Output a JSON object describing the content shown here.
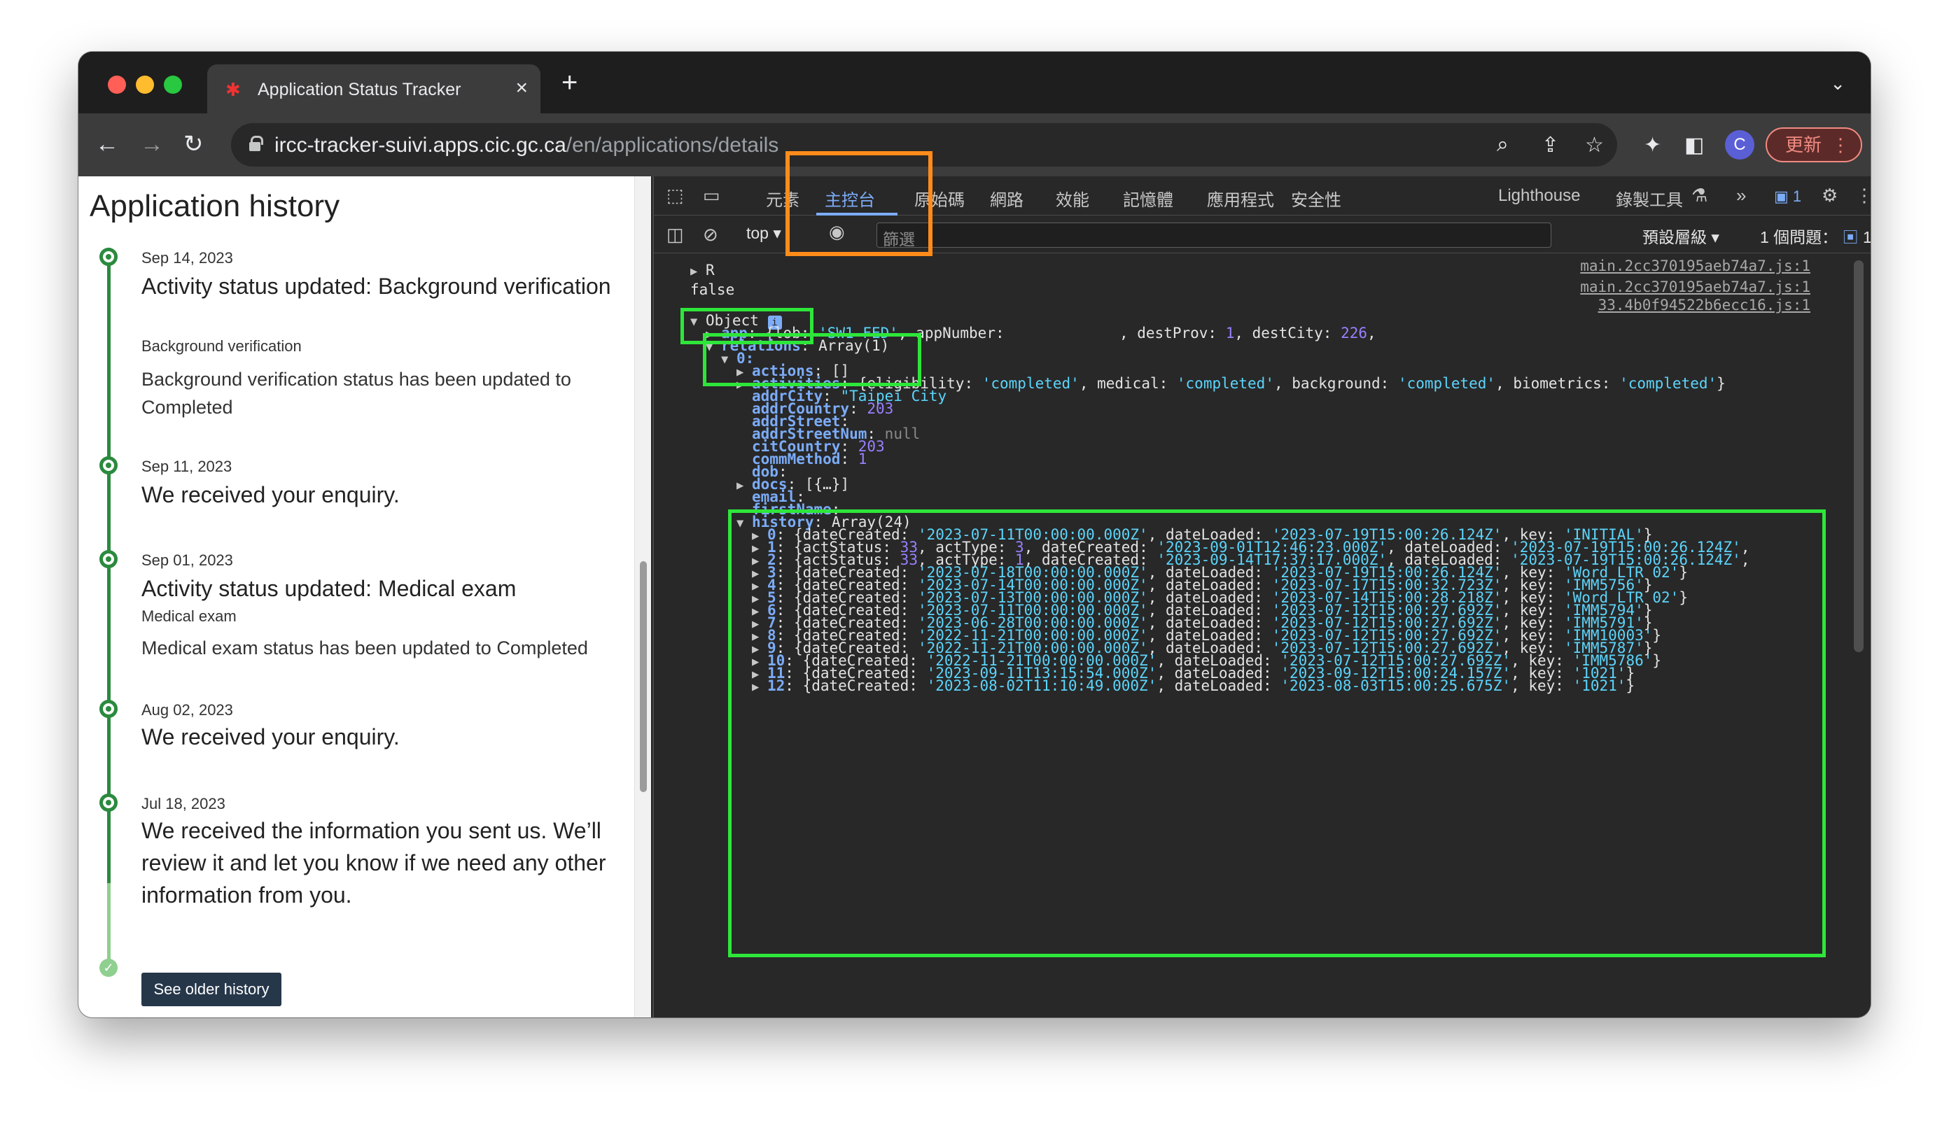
{
  "browser": {
    "tab_title": "Application Status Tracker",
    "url_host": "ircc-tracker-suivi.apps.cic.gc.ca",
    "url_path": "/en/applications/details",
    "avatar_letter": "C",
    "update_label": "更新"
  },
  "page": {
    "title": "Application history",
    "events": [
      {
        "date": "Sep 14, 2023",
        "title": "Activity status updated: Background verification",
        "subtitle": "Background verification",
        "description": "Background verification status has been updated to Completed"
      },
      {
        "date": "Sep 11, 2023",
        "title": "We received your enquiry."
      },
      {
        "date": "Sep 01, 2023",
        "title": "Activity status updated: Medical exam",
        "subtitle": "Medical exam",
        "description": "Medical exam status has been updated to Completed"
      },
      {
        "date": "Aug 02, 2023",
        "title": "We received your enquiry."
      },
      {
        "date": "Jul 18, 2023",
        "title": "We received the information you sent us. We’ll review it and let you know if we need any other information from you."
      }
    ],
    "older_button": "See older history"
  },
  "devtools": {
    "tabs": [
      "元素",
      "主控台",
      "原始碼",
      "網路",
      "效能",
      "記憶體",
      "應用程式",
      "安全性",
      "Lighthouse",
      "錄製工具"
    ],
    "active_tab": "主控台",
    "issue_badge_count": "1",
    "context": "top",
    "filter_placeholder": "篩選",
    "default_levels": "預設層級",
    "issues_label": "1 個問題：",
    "issues_count": "1",
    "sources": [
      "main.2cc370195aeb74a7.js:1",
      "main.2cc370195aeb74a7.js:1",
      "33.4b0f94522b6ecc16.js:1"
    ],
    "console": {
      "line_r": "R",
      "line_false": "false",
      "object_label": "Object",
      "app_key": "app",
      "app_value_start": "{lob: ",
      "app_lob": "'SW1-FED'",
      "app_value_mid": ", appNumber: ",
      "app_value_rest": ", destProv: ",
      "app_destProv": "1",
      "app_destCity_label": ", destCity: ",
      "app_destCity": "226",
      "relations_key": "relations",
      "relations_value": "Array(1)",
      "index0": "0:",
      "actions_key": "actions",
      "actions_value": "[]",
      "activities_key": "activities",
      "activities_eligibility": "'completed'",
      "activities_medical": "'completed'",
      "activities_background": "'completed'",
      "activities_biometrics": "'completed'",
      "addrCity_key": "addrCity",
      "addrCity_value": "\"Taipei City",
      "addrCountry_key": "addrCountry",
      "addrCountry_value": "203",
      "addrStreet_key": "addrStreet",
      "addrStreetNum_key": "addrStreetNum",
      "addrStreetNum_value": "null",
      "citCountry_key": "citCountry",
      "citCountry_value": "203",
      "commMethod_key": "commMethod",
      "commMethod_value": "1",
      "dob_key": "dob",
      "docs_key": "docs",
      "docs_value": "[{…}]",
      "email_key": "email",
      "firstName_key": "firstName",
      "history_key": "history",
      "history_value": "Array(24)",
      "history": [
        {
          "idx": "0",
          "dateCreated": "'2023-07-11T00:00:00.000Z'",
          "dateLoaded": "'2023-07-19T15:00:26.124Z'",
          "key": "'INITIAL'"
        },
        {
          "idx": "1",
          "actStatus": "33",
          "actType": "3",
          "dateCreated": "'2023-09-01T12:46:23.000Z'",
          "dateLoaded": "'2023-07-19T15:00:26.124Z'"
        },
        {
          "idx": "2",
          "actStatus": "33",
          "actType": "1",
          "dateCreated": "'2023-09-14T17:37:17.000Z'",
          "dateLoaded": "'2023-07-19T15:00:26.124Z'"
        },
        {
          "idx": "3",
          "dateCreated": "'2023-07-18T00:00:00.000Z'",
          "dateLoaded": "'2023-07-19T15:00:26.124Z'",
          "key": "'Word LTR 02'"
        },
        {
          "idx": "4",
          "dateCreated": "'2023-07-14T00:00:00.000Z'",
          "dateLoaded": "'2023-07-17T15:00:32.723Z'",
          "key": "'IMM5756'"
        },
        {
          "idx": "5",
          "dateCreated": "'2023-07-13T00:00:00.000Z'",
          "dateLoaded": "'2023-07-14T15:00:28.218Z'",
          "key": "'Word LTR 02'"
        },
        {
          "idx": "6",
          "dateCreated": "'2023-07-11T00:00:00.000Z'",
          "dateLoaded": "'2023-07-12T15:00:27.692Z'",
          "key": "'IMM5794'"
        },
        {
          "idx": "7",
          "dateCreated": "'2023-06-28T00:00:00.000Z'",
          "dateLoaded": "'2023-07-12T15:00:27.692Z'",
          "key": "'IMM5791'"
        },
        {
          "idx": "8",
          "dateCreated": "'2022-11-21T00:00:00.000Z'",
          "dateLoaded": "'2023-07-12T15:00:27.692Z'",
          "key": "'IMM10003'"
        },
        {
          "idx": "9",
          "dateCreated": "'2022-11-21T00:00:00.000Z'",
          "dateLoaded": "'2023-07-12T15:00:27.692Z'",
          "key": "'IMM5787'"
        },
        {
          "idx": "10",
          "dateCreated": "'2022-11-21T00:00:00.000Z'",
          "dateLoaded": "'2023-07-12T15:00:27.692Z'",
          "key": "'IMM5786'"
        },
        {
          "idx": "11",
          "dateCreated": "'2023-09-11T13:15:54.000Z'",
          "dateLoaded": "'2023-09-12T15:00:24.157Z'",
          "key": "'1021'"
        },
        {
          "idx": "12",
          "dateCreated": "'2023-08-02T11:10:49.000Z'",
          "dateLoaded": "'2023-08-03T15:00:25.675Z'",
          "key": "'1021'"
        }
      ]
    }
  },
  "colors": {
    "highlight_green": "#2ee63a",
    "highlight_orange": "#ff8c1a",
    "timeline_green": "#2b8a3e",
    "button_navy": "#26374a"
  }
}
